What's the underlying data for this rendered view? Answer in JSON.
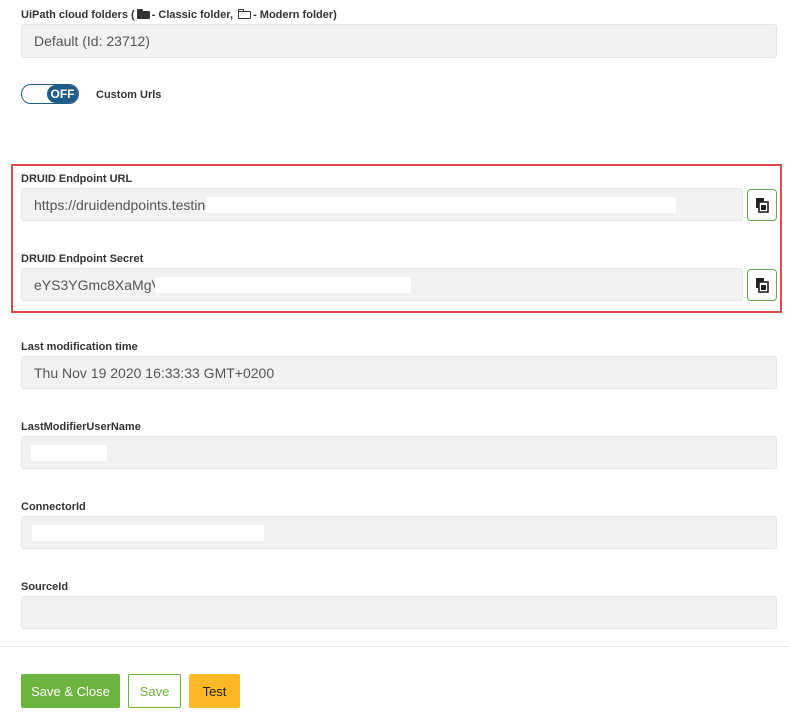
{
  "folders": {
    "label_prefix": "UiPath cloud folders (",
    "classic_label": "- Classic folder,",
    "modern_label": "- Modern folder)",
    "value": "Default (Id: 23712)"
  },
  "custom_urls": {
    "toggle_state": "OFF",
    "label": "Custom Urls"
  },
  "druid_url": {
    "label": "DRUID Endpoint URL",
    "value": "https://druidendpoints.testing."
  },
  "druid_secret": {
    "label": "DRUID Endpoint Secret",
    "value": "eYS3YGmc8XaMgV"
  },
  "last_modification": {
    "label": "Last modification time",
    "value": "Thu Nov 19 2020 16:33:33 GMT+0200"
  },
  "last_modifier": {
    "label": "LastModifierUserName",
    "value": ""
  },
  "connector": {
    "label": "ConnectorId",
    "value": ""
  },
  "source": {
    "label": "SourceId",
    "value": ""
  },
  "buttons": {
    "save_close": "Save & Close",
    "save": "Save",
    "test": "Test"
  },
  "colors": {
    "green": "#6db33f",
    "yellow": "#fdb827",
    "toggle_blue": "#1d5b89",
    "highlight_red": "#e04b4b"
  }
}
